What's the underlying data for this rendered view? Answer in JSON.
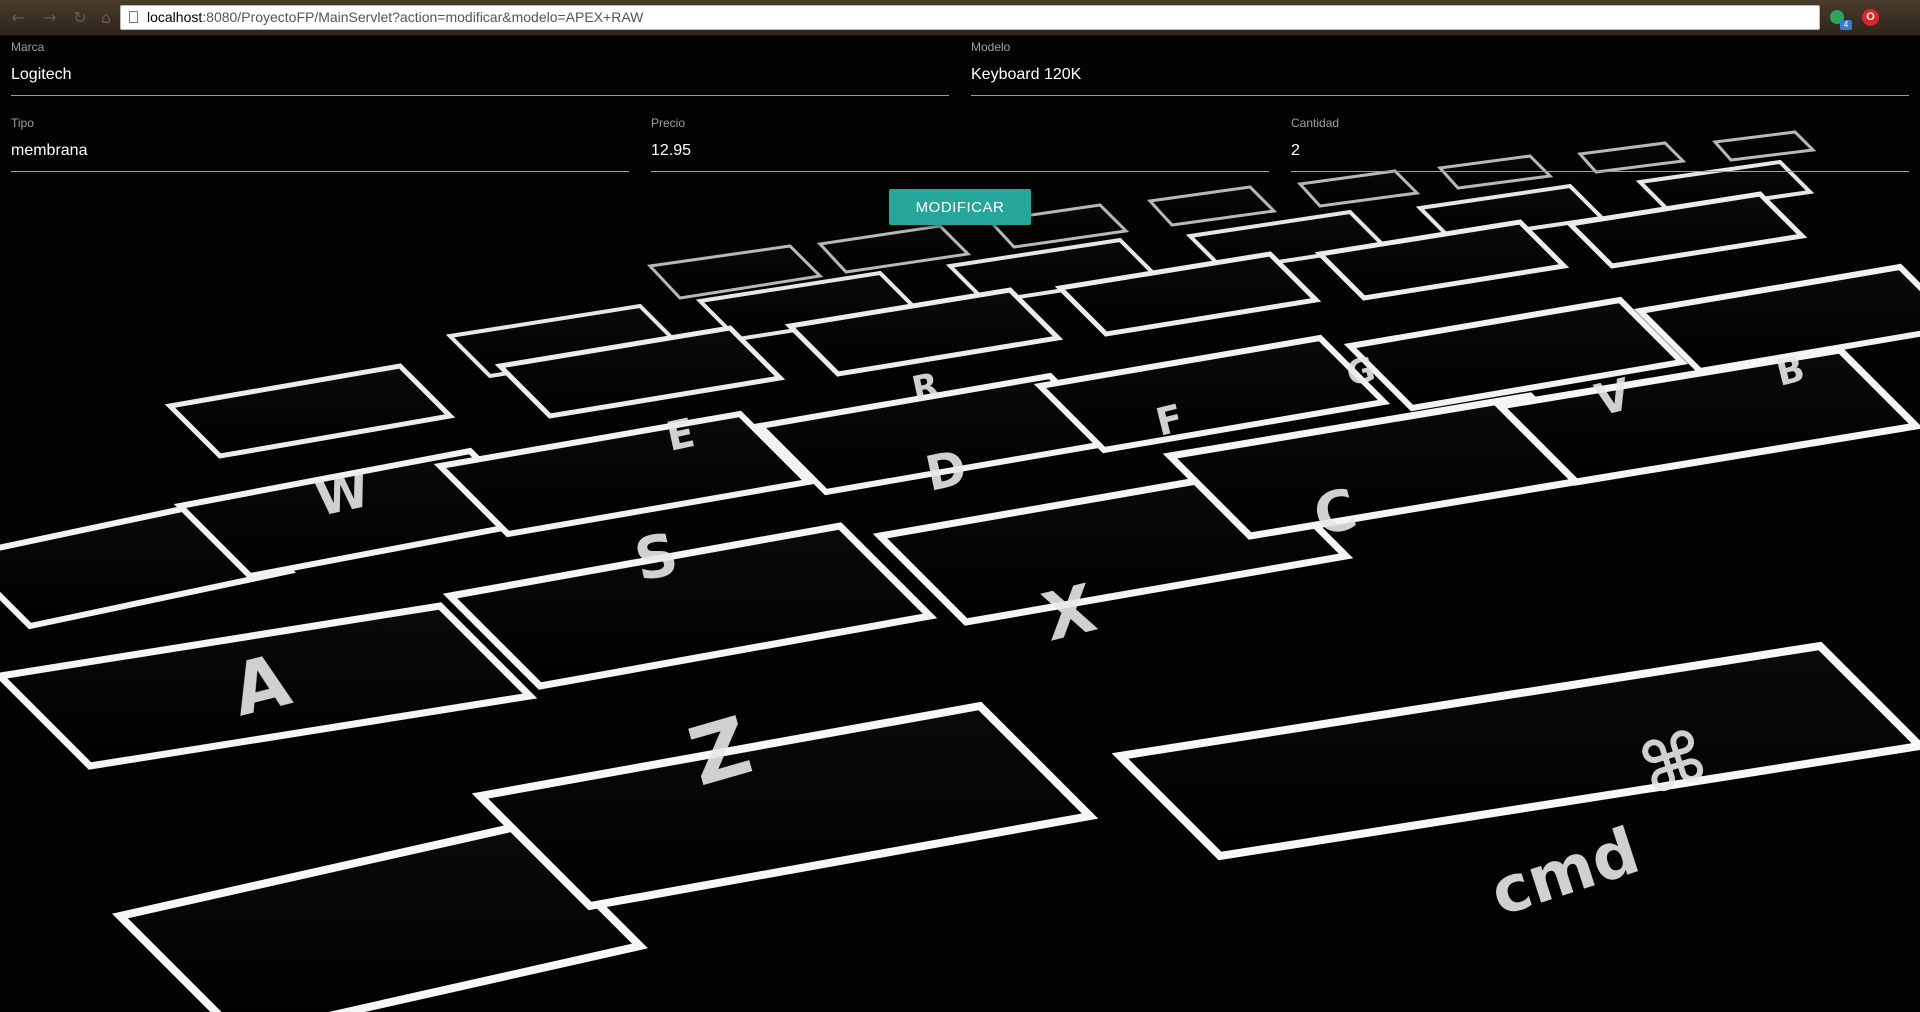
{
  "browser": {
    "url_host": "localhost",
    "url_rest": ":8080/ProyectoFP/MainServlet?action=modificar&modelo=APEX+RAW",
    "extension_badge": "4",
    "extension2_icon": "opera-icon"
  },
  "form": {
    "marca": {
      "label": "Marca",
      "value": "Logitech"
    },
    "modelo": {
      "label": "Modelo",
      "value": "Keyboard 120K"
    },
    "tipo": {
      "label": "Tipo",
      "value": "membrana"
    },
    "precio": {
      "label": "Precio",
      "value": "12.95"
    },
    "cantidad": {
      "label": "Cantidad",
      "value": "2"
    },
    "submit_label": "MODIFICAR"
  },
  "colors": {
    "accent": "#26a69a",
    "background": "#000000",
    "field_line": "#9e9e9e"
  }
}
